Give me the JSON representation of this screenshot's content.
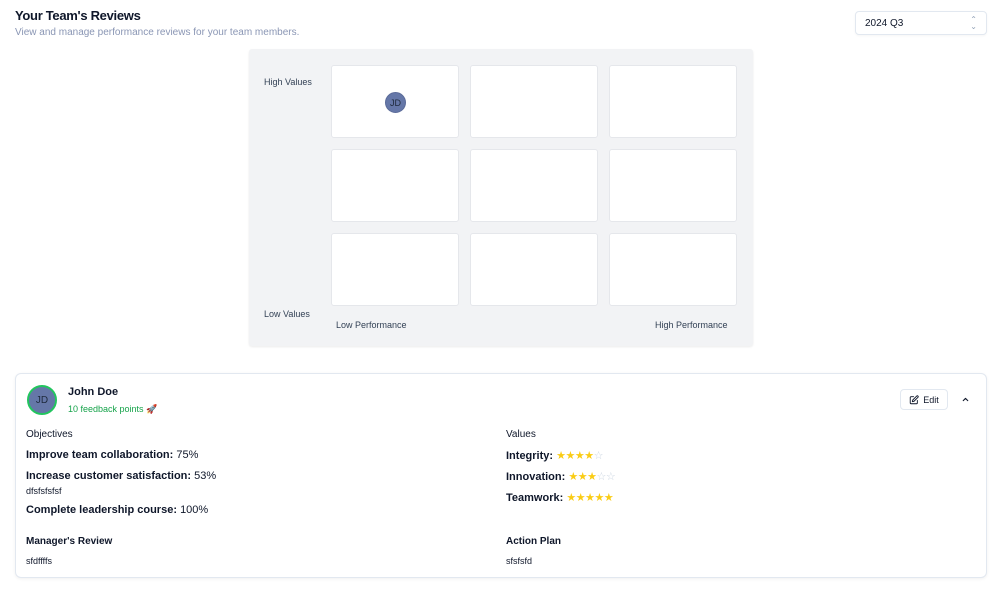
{
  "header": {
    "title": "Your Team's Reviews",
    "subtitle": "View and manage performance reviews for your team members."
  },
  "quarter_select": {
    "value": "2024 Q3"
  },
  "grid": {
    "y_high": "High Values",
    "y_low": "Low Values",
    "x_low": "Low Performance",
    "x_high": "High Performance",
    "placements": [
      {
        "initials": "JD",
        "row": 0,
        "col": 0
      }
    ]
  },
  "review": {
    "initials": "JD",
    "name": "John Doe",
    "feedback": "10 feedback points 🚀",
    "edit_label": "Edit",
    "objectives_heading": "Objectives",
    "objectives": [
      {
        "label": "Improve team collaboration:",
        "value": "75%",
        "note": ""
      },
      {
        "label": "Increase customer satisfaction:",
        "value": "53%",
        "note": "dfsfsfsfsf"
      },
      {
        "label": "Complete leadership course:",
        "value": "100%",
        "note": ""
      }
    ],
    "values_heading": "Values",
    "values": [
      {
        "label": "Integrity:",
        "rating": 4,
        "max": 5
      },
      {
        "label": "Innovation:",
        "rating": 3,
        "max": 5
      },
      {
        "label": "Teamwork:",
        "rating": 5,
        "max": 5
      }
    ],
    "managers_review_heading": "Manager's Review",
    "managers_review": "sfdffffs",
    "action_plan_heading": "Action Plan",
    "action_plan": "sfsfsfd"
  },
  "colors": {
    "accent_green": "#16a34a",
    "star": "#facc15",
    "avatar": "#6577a8"
  }
}
